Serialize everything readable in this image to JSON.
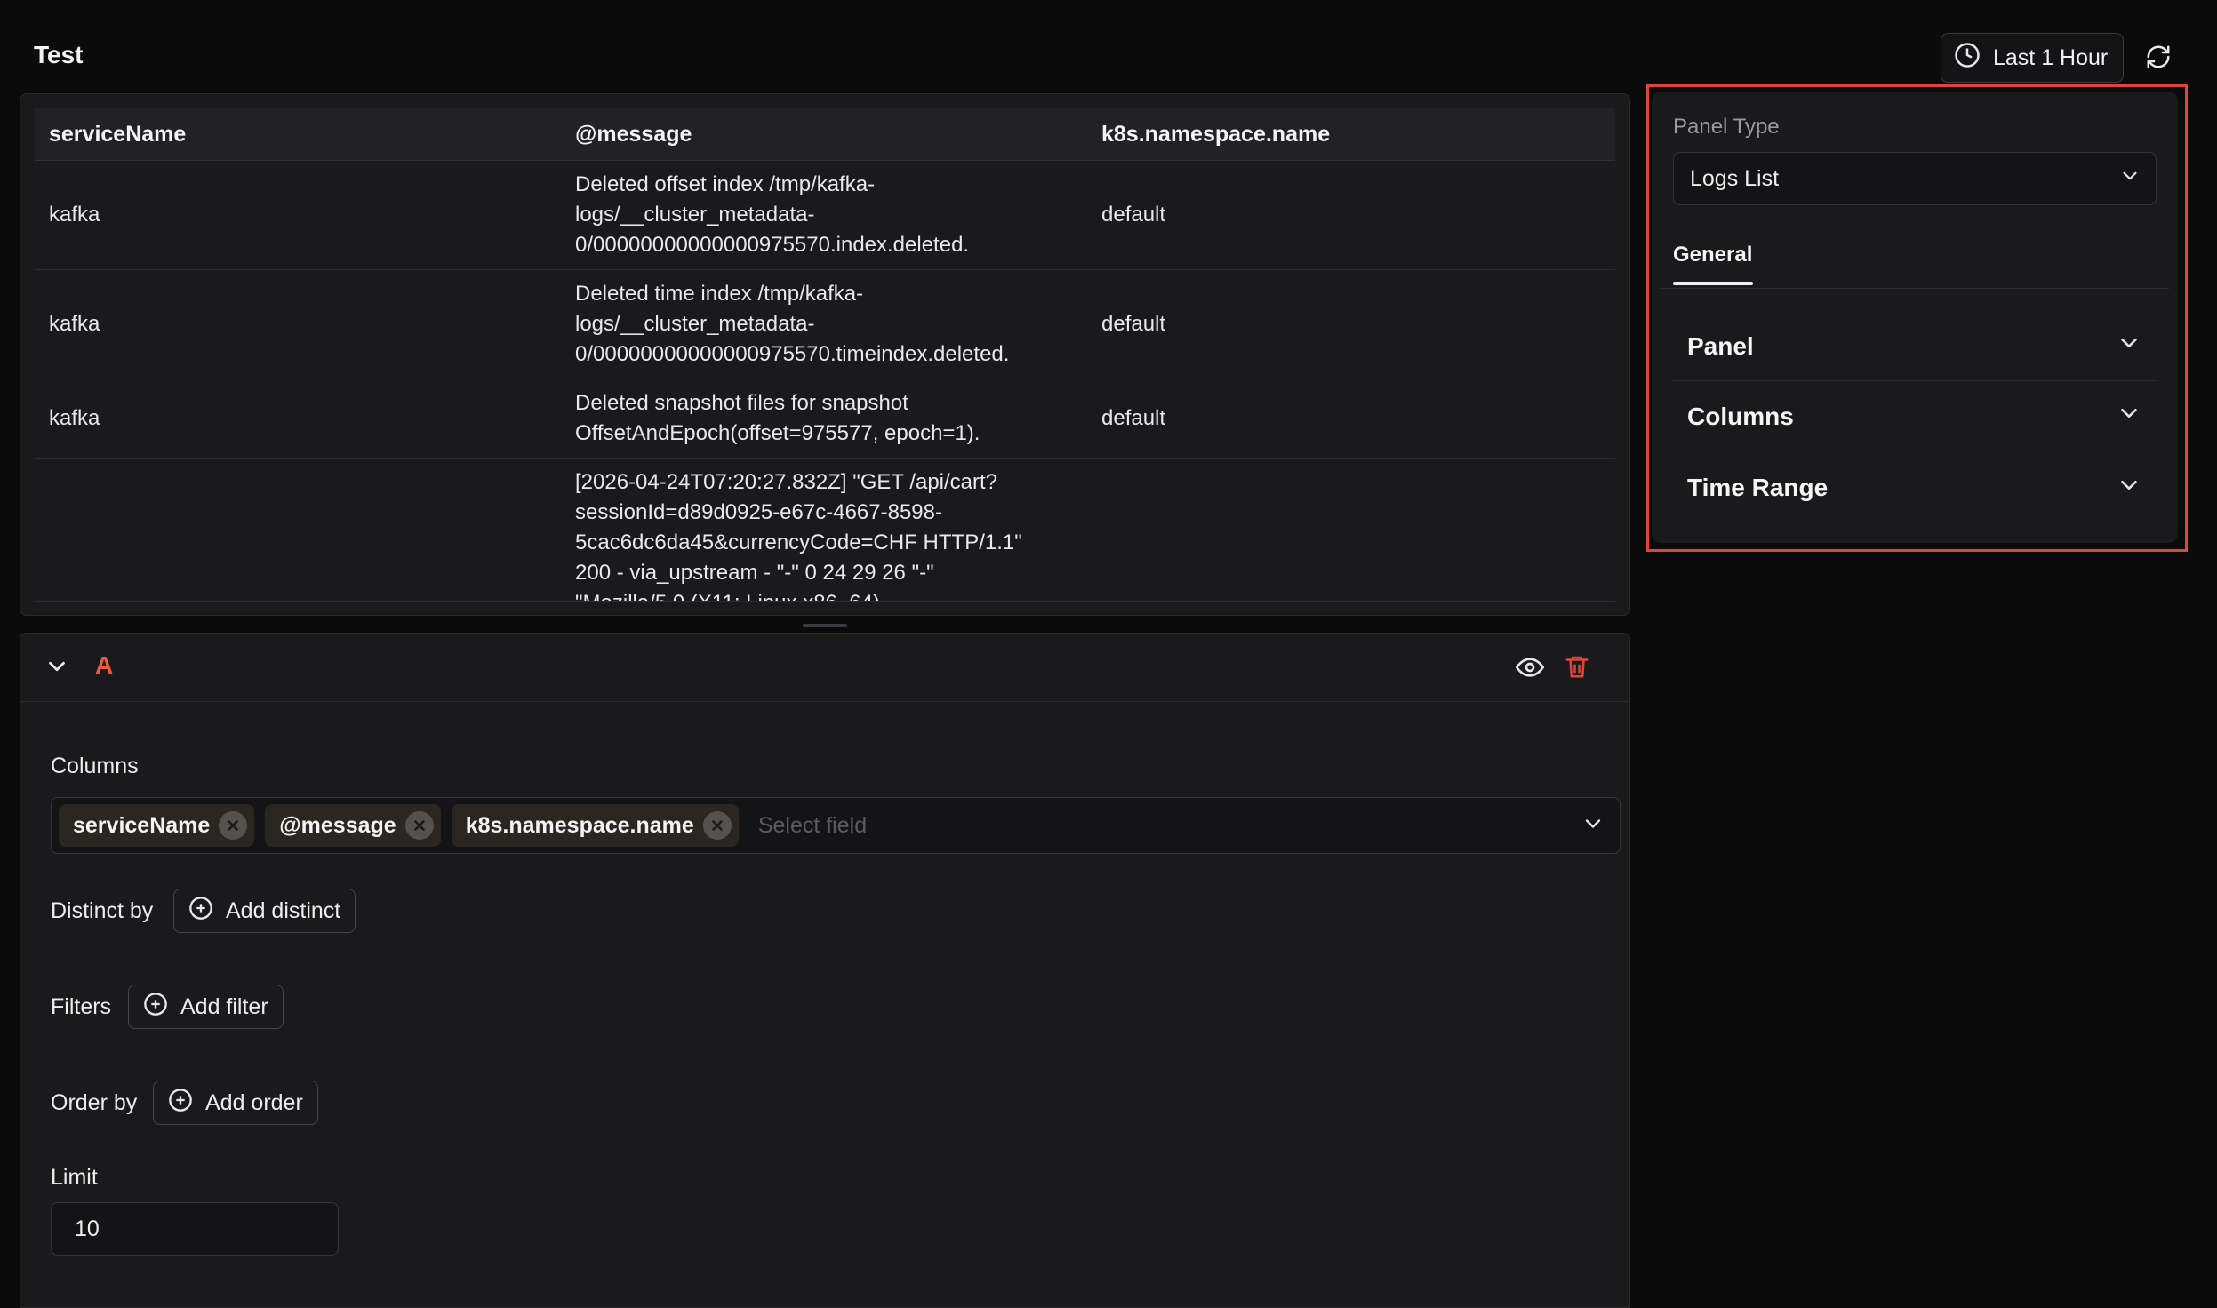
{
  "header": {
    "title": "Test",
    "time_range_label": "Last 1 Hour"
  },
  "results_table": {
    "columns": [
      "serviceName",
      "@message",
      "k8s.namespace.name"
    ],
    "rows": [
      {
        "serviceName": "kafka",
        "message": "Deleted offset index /tmp/kafka-\nlogs/__cluster_metadata-\n0/00000000000000975570.index.deleted.",
        "namespace": "default"
      },
      {
        "serviceName": "kafka",
        "message": "Deleted time index /tmp/kafka-\nlogs/__cluster_metadata-\n0/00000000000000975570.timeindex.deleted.",
        "namespace": "default"
      },
      {
        "serviceName": "kafka",
        "message": "Deleted snapshot files for snapshot\nOffsetAndEpoch(offset=975577, epoch=1).",
        "namespace": "default"
      },
      {
        "serviceName": "",
        "message": "[2026-04-24T07:20:27.832Z] \"GET /api/cart?\nsessionId=d89d0925-e67c-4667-8598-\n5cac6dc6da45&currencyCode=CHF HTTP/1.1\"\n200 - via_upstream - \"-\" 0 24 29 26 \"-\"\n\"Mozilla/5.0 (X11; Linux x86_64)",
        "namespace": ""
      }
    ]
  },
  "query": {
    "letter": "A",
    "columns_label": "Columns",
    "selected_columns": [
      "serviceName",
      "@message",
      "k8s.namespace.name"
    ],
    "select_field_placeholder": "Select field",
    "distinct_label": "Distinct by",
    "add_distinct": "Add distinct",
    "filters_label": "Filters",
    "add_filter": "Add filter",
    "order_label": "Order by",
    "add_order": "Add order",
    "limit_label": "Limit",
    "limit_value": "10"
  },
  "side_panel": {
    "panel_type_label": "Panel Type",
    "panel_type_value": "Logs List",
    "tab_general": "General",
    "sections": [
      "Panel",
      "Columns",
      "Time Range"
    ]
  },
  "colors": {
    "accent_red": "#e0443a",
    "query_letter": "#ef5a3c",
    "background": "#0b0b0c",
    "panel": "#1a1a1d"
  }
}
